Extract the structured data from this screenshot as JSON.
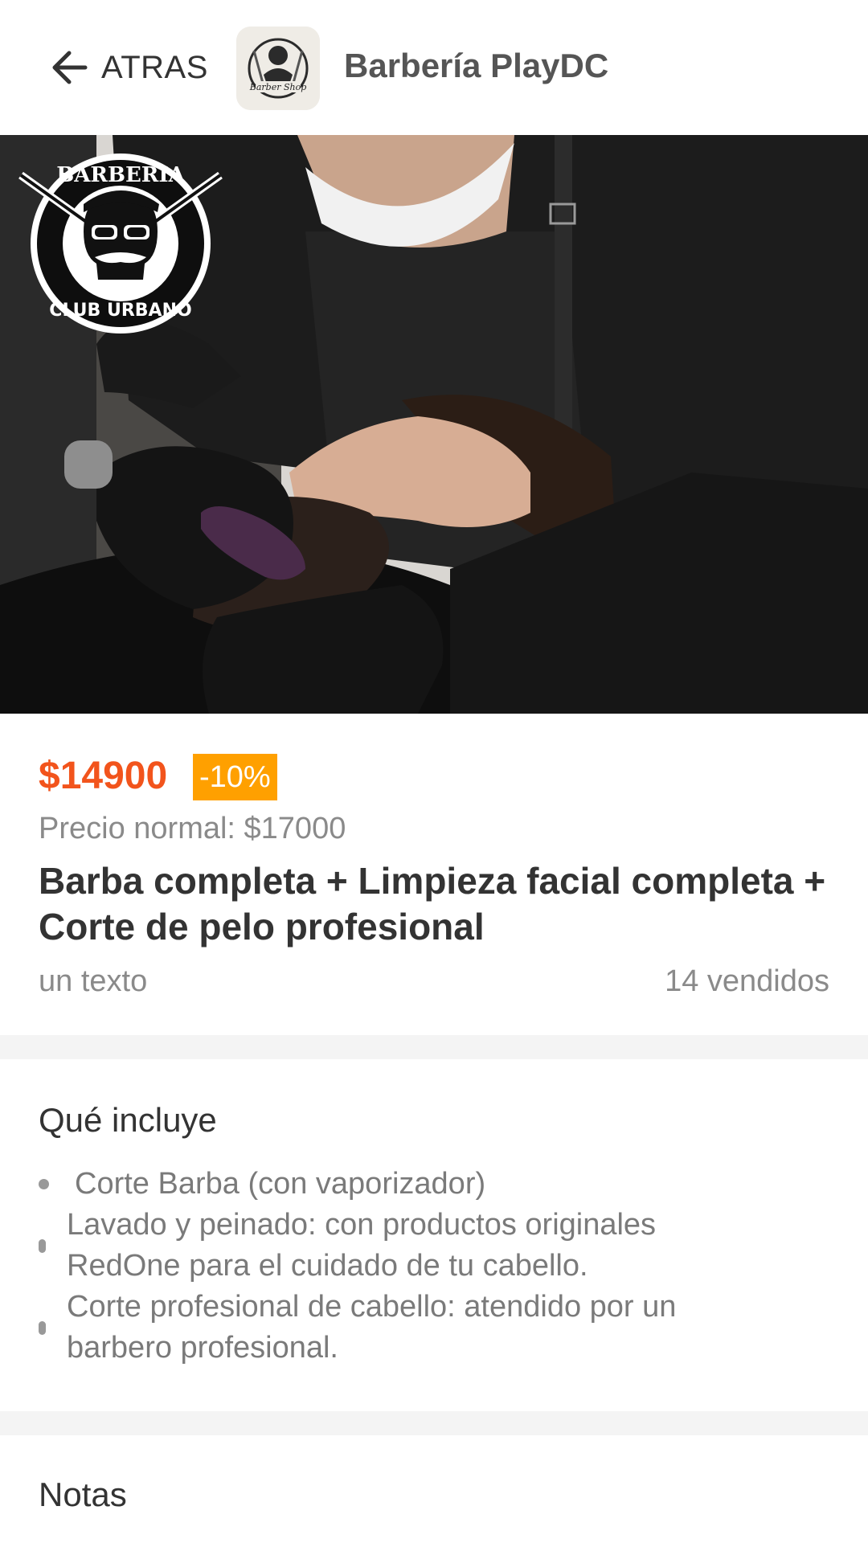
{
  "header": {
    "back_label": "ATRAS",
    "shop_name": "Barbería PlayDC",
    "shop_logo_text": "Barber Shop"
  },
  "hero": {
    "logo_top_text": "BARBERIA",
    "logo_bottom_text": "CLUB URBANO"
  },
  "product": {
    "price": "$14900",
    "discount": "-10%",
    "normal_price": "Precio normal: $17000",
    "title": "Barba completa + Limpieza facial completa + Corte de pelo profesional",
    "subtext": "un texto",
    "sold": "14 vendidos"
  },
  "includes": {
    "title": "Qué incluye",
    "items": [
      "Corte Barba (con vaporizador)",
      "Lavado y peinado: con productos originales RedOne para el cuidado de tu cabello.",
      "Corte profesional de cabello: atendido por un barbero profesional."
    ]
  },
  "notes": {
    "title": "Notas"
  },
  "colors": {
    "price": "#f2541c",
    "discount_bg": "#ffa000",
    "separator": "#f4f4f4"
  }
}
